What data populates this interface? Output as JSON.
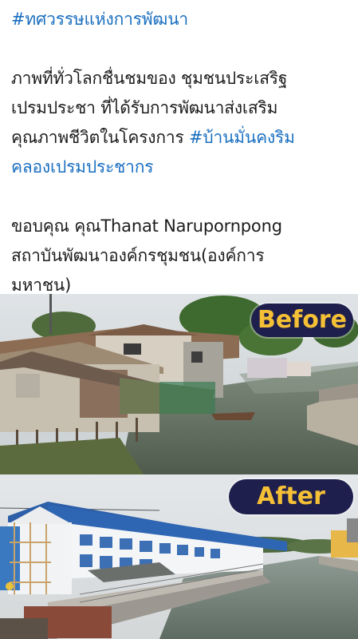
{
  "post": {
    "hashtag_title": "#ทศวรรษแห่งการพัฒนา",
    "para1_line1": "ภาพที่ทั่วโลกชื่นชมของ ชุมชนประเสริฐ",
    "para1_line2": "เปรมประชา ที่ได้รับการพัฒนาส่งเสริม",
    "para1_line3_text": "คุณภาพชีวิตในโครงการ ",
    "para1_line3_tag": "#บ้านมั่นคงริม",
    "para1_line4_tag": "คลองเปรมประชากร",
    "para2_line1": "ขอบคุณ คุณThanat Narupornpong",
    "para2_line2": "สถาบันพัฒนาองค์กรชุมชน(องค์การ",
    "para2_line3": "มหาชน)"
  },
  "images": {
    "before_label": "Before",
    "after_label": "After"
  },
  "colors": {
    "hashtag": "#1a6fc0",
    "text": "#1c1c1c",
    "label_bg": "#1f1f4d",
    "label_text": "#f5c035"
  }
}
